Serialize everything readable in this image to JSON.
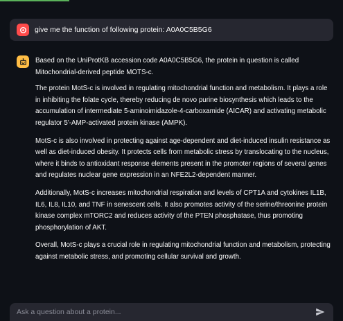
{
  "user_message": {
    "text": "give me the function of following protein: A0A0C5B5G6"
  },
  "assistant_message": {
    "paragraphs": [
      "Based on the UniProtKB accession code A0A0C5B5G6, the protein in question is called Mitochondrial-derived peptide MOTS-c.",
      "The protein MotS-c is involved in regulating mitochondrial function and metabolism. It plays a role in inhibiting the folate cycle, thereby reducing de novo purine biosynthesis which leads to the accumulation of intermediate 5-aminoimidazole-4-carboxamide (AICAR) and activating metabolic regulator 5'-AMP-activated protein kinase (AMPK).",
      "MotS-c is also involved in protecting against age-dependent and diet-induced insulin resistance as well as diet-induced obesity. It protects cells from metabolic stress by translocating to the nucleus, where it binds to antioxidant response elements present in the promoter regions of several genes and regulates nuclear gene expression in an NFE2L2-dependent manner.",
      "Additionally, MotS-c increases mitochondrial respiration and levels of CPT1A and cytokines IL1B, IL6, IL8, IL10, and TNF in senescent cells. It also promotes activity of the serine/threonine protein kinase complex mTORC2 and reduces activity of the PTEN phosphatase, thus promoting phosphorylation of AKT.",
      "Overall, MotS-c plays a crucial role in regulating mitochondrial function and metabolism, protecting against metabolic stress, and promoting cellular survival and growth."
    ]
  },
  "chat_input": {
    "value": "",
    "placeholder": "Ask a question about a protein..."
  },
  "icons": {
    "user_avatar": "user-avatar-icon",
    "assistant_avatar": "assistant-avatar-icon",
    "send": "send-icon"
  },
  "colors": {
    "background": "#0e1117",
    "message_background": "#262730",
    "user_avatar": "#ff4b4b",
    "assistant_avatar": "#ffbd45",
    "accent": "#5ab25a"
  }
}
